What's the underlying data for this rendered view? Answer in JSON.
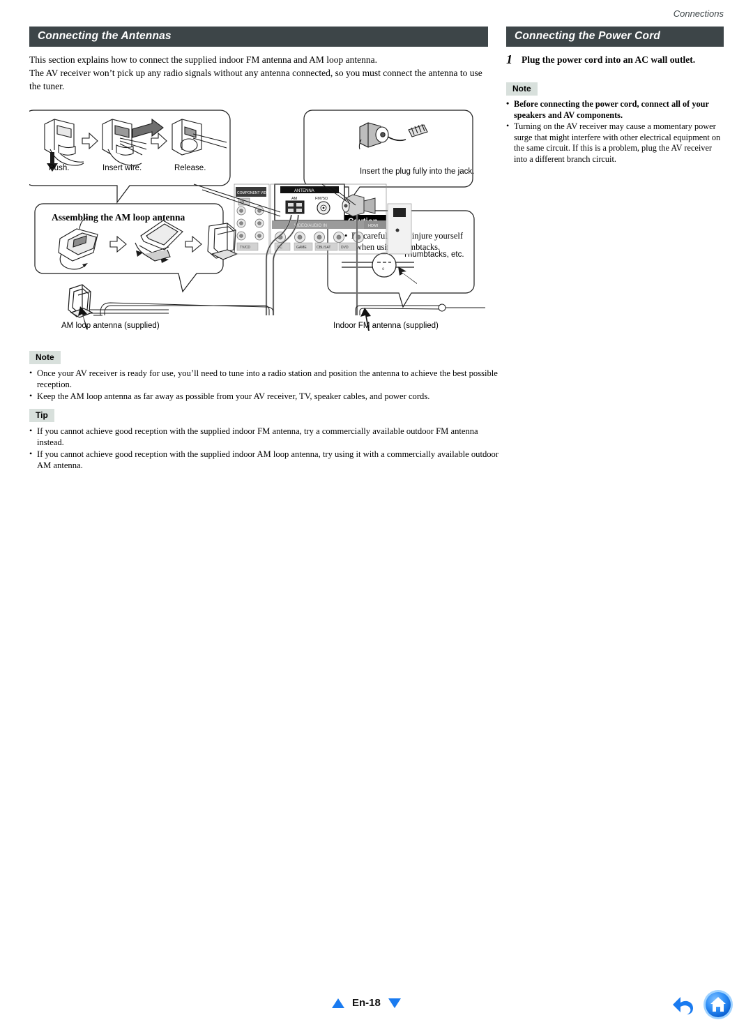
{
  "running_head": "Connections",
  "left_column": {
    "section_title": "Connecting the Antennas",
    "intro_p1": "This section explains how to connect the supplied indoor FM antenna and AM loop antenna.",
    "intro_p2": "The AV receiver won’t pick up any radio signals without any antenna connected, so you must connect the antenna to use the tuner.",
    "note_badge": "Note",
    "note_items": [
      "Once your AV receiver is ready for use, you’ll need to tune into a radio station and position the antenna to achieve the best possible reception.",
      "Keep the AM loop antenna as far away as possible from your AV receiver, TV, speaker cables, and power cords."
    ],
    "tip_badge": "Tip",
    "tip_items": [
      "If you cannot achieve good reception with the supplied indoor FM antenna, try a commercially available outdoor FM antenna instead.",
      "If you cannot achieve good reception with the supplied indoor AM loop antenna, try using it with a commercially available outdoor AM antenna."
    ]
  },
  "right_column": {
    "section_title": "Connecting the Power Cord",
    "step_number": "1",
    "step_text": "Plug the power cord into an AC wall outlet.",
    "note_badge": "Note",
    "note_items": [
      "Before connecting the power cord, connect all of your speakers and AV components.",
      "Turning on the AV receiver may cause a momentary power surge that might interfere with other electrical equipment on the same circuit. If this is a problem, plug the AV receiver into a different branch circuit."
    ]
  },
  "diagram": {
    "wire_steps": [
      "Push.",
      "Insert wire.",
      "Release."
    ],
    "am_loop_title": "Assembling the AM loop antenna",
    "plug_caption": "Insert the plug fully into the jack.",
    "caution_badge": "Caution",
    "caution_text": "Be careful not to injure yourself when using thumbtacks.",
    "thumbtacks_label": "Thumbtacks, etc.",
    "am_antenna_label": "AM loop antenna (supplied)",
    "fm_antenna_label": "Indoor FM antenna (supplied)",
    "panel": {
      "antenna_label": "ANTENNA",
      "am_label": "AM",
      "fm_label": "FM75Ω",
      "left_group_label": "COMPONENT VIDEO",
      "left_sub_label": "IN",
      "row_label": "VIDEO/AUDIO IN",
      "right_label": "HDMI",
      "jack_labels": [
        "TV/CD",
        "PC",
        "GAME",
        "CBL/SAT",
        "DVD"
      ]
    }
  },
  "footer": {
    "page_label": "En-18",
    "prev_icon": "triangle-up-icon",
    "next_icon": "triangle-down-icon",
    "back_icon": "back-arrow-icon",
    "home_icon": "home-icon"
  },
  "colors": {
    "header_bar": "#3d4548",
    "badge_bg": "#d8e0dc",
    "accent_blue": "#1a7bf0",
    "caution_bg": "#000000"
  }
}
